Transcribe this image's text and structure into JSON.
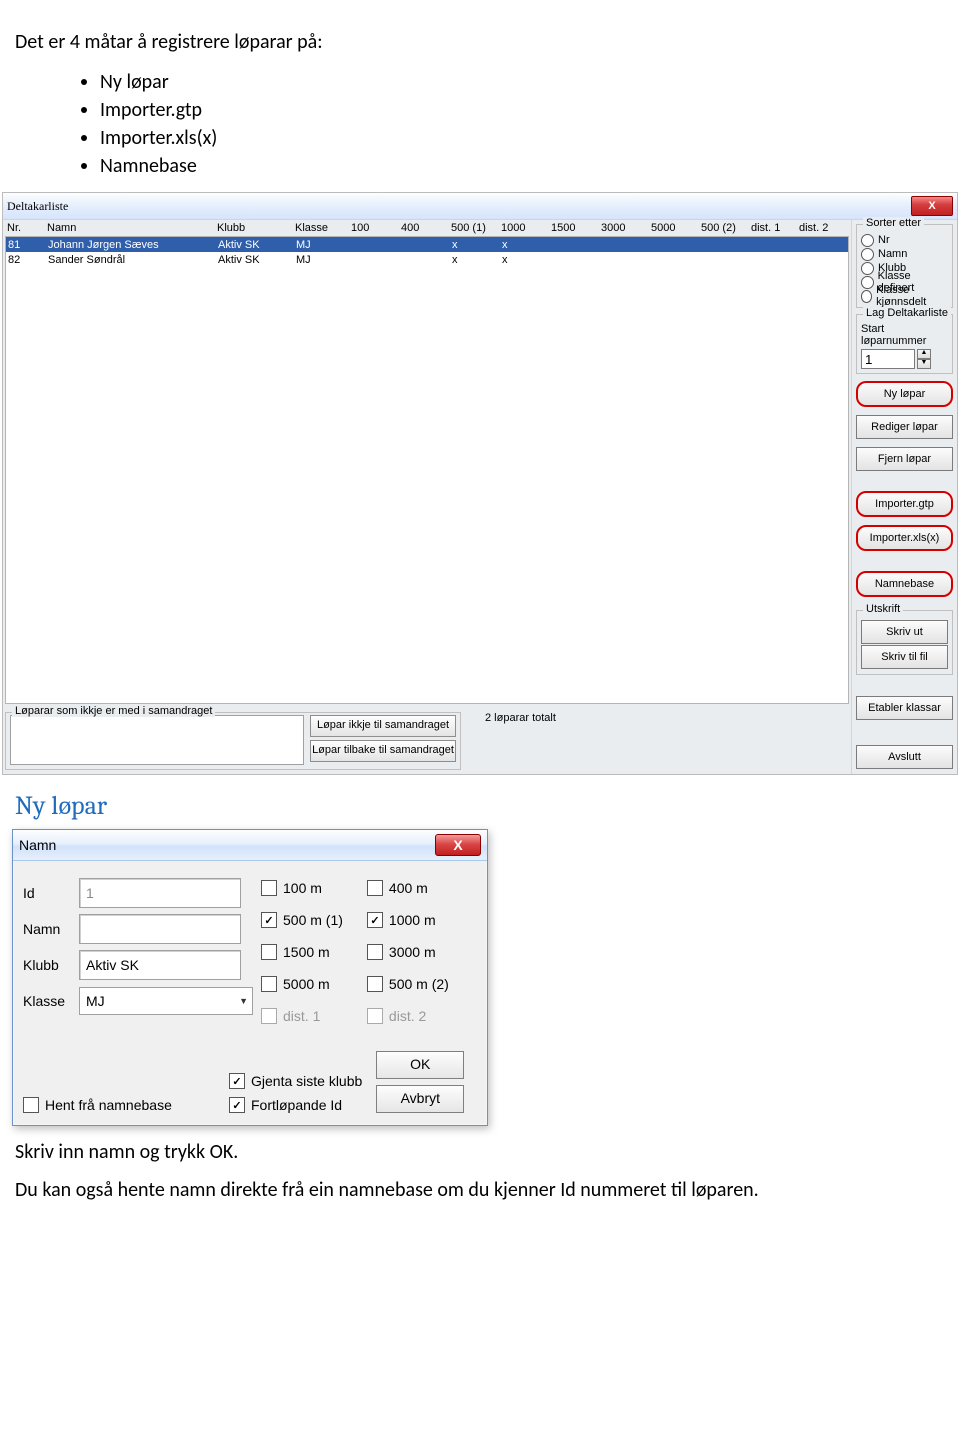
{
  "doc": {
    "intro": "Det er 4 måtar å registrere løparar på:",
    "bullets": [
      "Ny løpar",
      "Importer.gtp",
      "Importer.xls(x)",
      "Namnebase"
    ],
    "heading": "Ny løpar",
    "outro1": "Skriv inn namn og trykk OK.",
    "outro2": "Du kan også hente namn direkte frå ein namnebase om du kjenner Id nummeret til løparen."
  },
  "dl": {
    "title": "Deltakarliste",
    "close": "X",
    "cols": [
      "Nr.",
      "Namn",
      "Klubb",
      "Klasse",
      "100",
      "400",
      "500 (1)",
      "1000",
      "1500",
      "3000",
      "5000",
      "500 (2)",
      "dist. 1",
      "dist. 2"
    ],
    "rows": [
      {
        "nr": "81",
        "namn": "Johann Jørgen Sæves",
        "klubb": "Aktiv SK",
        "klasse": "MJ",
        "d": [
          "",
          "",
          "x",
          "x",
          "",
          "",
          "",
          "",
          "",
          ""
        ]
      },
      {
        "nr": "82",
        "namn": "Sander Søndrål",
        "klubb": "Aktiv SK",
        "klasse": "MJ",
        "d": [
          "",
          "",
          "x",
          "x",
          "",
          "",
          "",
          "",
          "",
          ""
        ]
      }
    ],
    "lower": {
      "legend": "Løparar som ikkje er med i samandraget",
      "btn1": "Løpar ikkje til samandraget",
      "btn2": "Løpar tilbake til samandraget",
      "total": "2 løparar totalt"
    },
    "side": {
      "sort_legend": "Sorter etter",
      "sort": [
        "Nr",
        "Namn",
        "Klubb",
        "Klasse definert",
        "Klasse kjønnsdelt"
      ],
      "lag_legend": "Lag Deltakarliste",
      "start_label": "Start løparnummer",
      "start_value": "1",
      "ny": "Ny løpar",
      "rediger": "Rediger løpar",
      "fjern": "Fjern løpar",
      "imp_gtp": "Importer.gtp",
      "imp_xls": "Importer.xls(x)",
      "namnebase": "Namnebase",
      "utskrift_legend": "Utskrift",
      "skriv_ut": "Skriv ut",
      "skriv_fil": "Skriv til fil",
      "etabler": "Etabler klassar",
      "avslutt": "Avslutt"
    }
  },
  "namn": {
    "title": "Namn",
    "close": "X",
    "fields": {
      "id_label": "Id",
      "id_value": "1",
      "namn_label": "Namn",
      "namn_value": "",
      "klubb_label": "Klubb",
      "klubb_value": "Aktiv SK",
      "klasse_label": "Klasse",
      "klasse_value": "MJ"
    },
    "dist": {
      "c100": "100 m",
      "c400": "400 m",
      "c500_1": "500 m (1)",
      "c1000": "1000 m",
      "c1500": "1500 m",
      "c3000": "3000 m",
      "c5000": "5000 m",
      "c500_2": "500 m (2)",
      "d1": "dist. 1",
      "d2": "dist. 2"
    },
    "lower": {
      "hent": "Hent frå namnebase",
      "gjenta": "Gjenta siste klubb",
      "fortl": "Fortløpande Id",
      "ok": "OK",
      "avbryt": "Avbryt"
    }
  }
}
